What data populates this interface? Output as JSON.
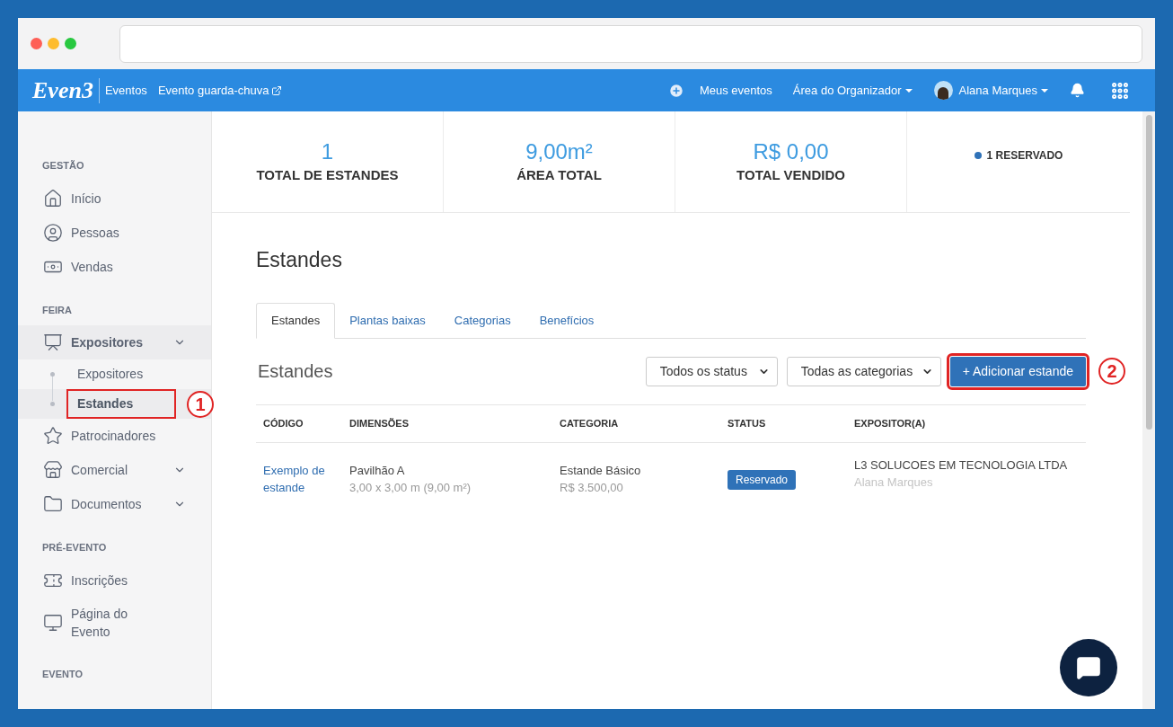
{
  "navbar": {
    "logo": "Even3",
    "section": "Eventos",
    "event_link": "Evento guarda-chuva",
    "links": [
      {
        "label": "Meus eventos",
        "kind": "plus"
      },
      {
        "label": "Área do Organizador",
        "kind": "dropdown"
      },
      {
        "label": "Alana Marques",
        "kind": "user"
      }
    ]
  },
  "sidebar": {
    "sections": [
      {
        "title": "GESTÃO",
        "items": [
          {
            "label": "Início",
            "selected": false
          },
          {
            "label": "Pessoas",
            "selected": false
          },
          {
            "label": "Vendas",
            "selected": false
          }
        ]
      },
      {
        "title": "FEIRA",
        "items": [
          {
            "label": "Expositores",
            "kind": "group",
            "selected": true,
            "children": [
              {
                "label": "Expositores",
                "selected": false
              },
              {
                "label": "Estandes",
                "selected": true,
                "callout": "1"
              }
            ]
          },
          {
            "label": "Patrocinadores",
            "kind": "link",
            "selected": false
          },
          {
            "label": "Comercial",
            "kind": "group",
            "selected": false
          },
          {
            "label": "Documentos",
            "kind": "group",
            "selected": false
          }
        ]
      },
      {
        "title": "PRÉ-EVENTO",
        "items": [
          {
            "label": "Inscrições",
            "selected": false
          },
          {
            "label": "Página do Evento",
            "selected": false
          }
        ]
      },
      {
        "title": "EVENTO"
      }
    ]
  },
  "stats": [
    {
      "value": "1",
      "label": "TOTAL DE ESTANDES"
    },
    {
      "value": "9,00m²",
      "label": "ÁREA TOTAL"
    },
    {
      "value": "R$ 0,00",
      "label": "TOTAL VENDIDO"
    }
  ],
  "legend": [
    {
      "label": "1 RESERVADO",
      "color": "#2f72b8"
    }
  ],
  "page_title": "Estandes",
  "tabs": [
    {
      "label": "Estandes",
      "selected": true
    },
    {
      "label": "Plantas baixas",
      "selected": false
    },
    {
      "label": "Categorias",
      "selected": false
    },
    {
      "label": "Benefícios",
      "selected": false
    }
  ],
  "section_title": "Estandes",
  "filters": [
    {
      "value": "Todos os status"
    },
    {
      "value": "Todas as categorias"
    }
  ],
  "add_button": {
    "label": "+ Adicionar estande",
    "callout": "2"
  },
  "table": {
    "columns": [
      "CÓDIGO",
      "DIMENSÕES",
      "CATEGORIA",
      "STATUS",
      "EXPOSITOR(A)"
    ],
    "rows": [
      {
        "code": "Exemplo de estande",
        "dimension": "Pavilhão A",
        "dimension_detail": "3,00 x 3,00 m (9,00 m²)",
        "category": "Estande Básico",
        "price": "R$ 3.500,00",
        "status": "Reservado",
        "exhibitor": "L3 SOLUCOES EM TECNOLOGIA LTDA",
        "exhibitor_contact": "Alana Marques"
      }
    ]
  }
}
